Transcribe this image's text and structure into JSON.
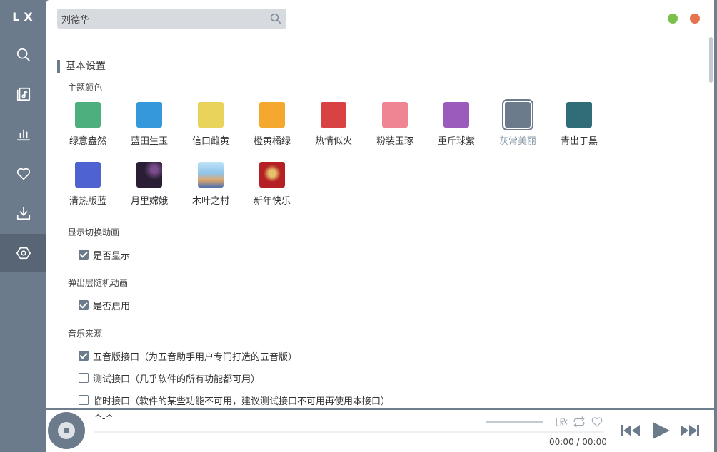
{
  "app": {
    "logo": "LX"
  },
  "search": {
    "value": "刘德华",
    "placeholder": ""
  },
  "sidebar": {
    "items": [
      "search",
      "songlist",
      "leaderboard",
      "favorites",
      "download",
      "settings"
    ]
  },
  "settings": {
    "section_title": "基本设置",
    "theme": {
      "label": "主题颜色",
      "items": [
        {
          "name": "绿意盎然",
          "color": "#4caf7d"
        },
        {
          "name": "蓝田生玉",
          "color": "#3498db"
        },
        {
          "name": "信口雌黄",
          "color": "#e9d35a"
        },
        {
          "name": "橙黄橘绿",
          "color": "#f5a830"
        },
        {
          "name": "热情似火",
          "color": "#d94242"
        },
        {
          "name": "粉装玉琢",
          "color": "#ef8593"
        },
        {
          "name": "重斤球紫",
          "color": "#9a5bbd"
        },
        {
          "name": "灰常美丽",
          "color": "#6b7b8b",
          "selected": true
        },
        {
          "name": "青出于黑",
          "color": "#306d78"
        },
        {
          "name": "清热版蓝",
          "color": "#4e63cf"
        },
        {
          "name": "月里嫦娥",
          "color": "#2a1e34"
        },
        {
          "name": "木叶之村",
          "color": "#8fc4ea"
        },
        {
          "name": "新年快乐",
          "color": "#b52024"
        }
      ]
    },
    "animation": {
      "label": "显示切换动画",
      "option": "是否显示",
      "checked": true
    },
    "popup": {
      "label": "弹出层随机动画",
      "option": "是否启用",
      "checked": true
    },
    "source": {
      "label": "音乐来源",
      "options": [
        {
          "label": "五音版接口（为五音助手用户专门打造的五音版）",
          "checked": true
        },
        {
          "label": "测试接口（几乎软件的所有功能都可用）",
          "checked": false
        },
        {
          "label": "临时接口（软件的某些功能不可用，建议测试接口不可用再使用本接口）",
          "checked": false
        }
      ]
    }
  },
  "player": {
    "track": "^-^",
    "time": "00:00 / 00:00",
    "lrc_label": "LRC"
  },
  "colors": {
    "accent": "#6b7b8b",
    "minimize": "#7ac14b",
    "close": "#e7734e"
  }
}
